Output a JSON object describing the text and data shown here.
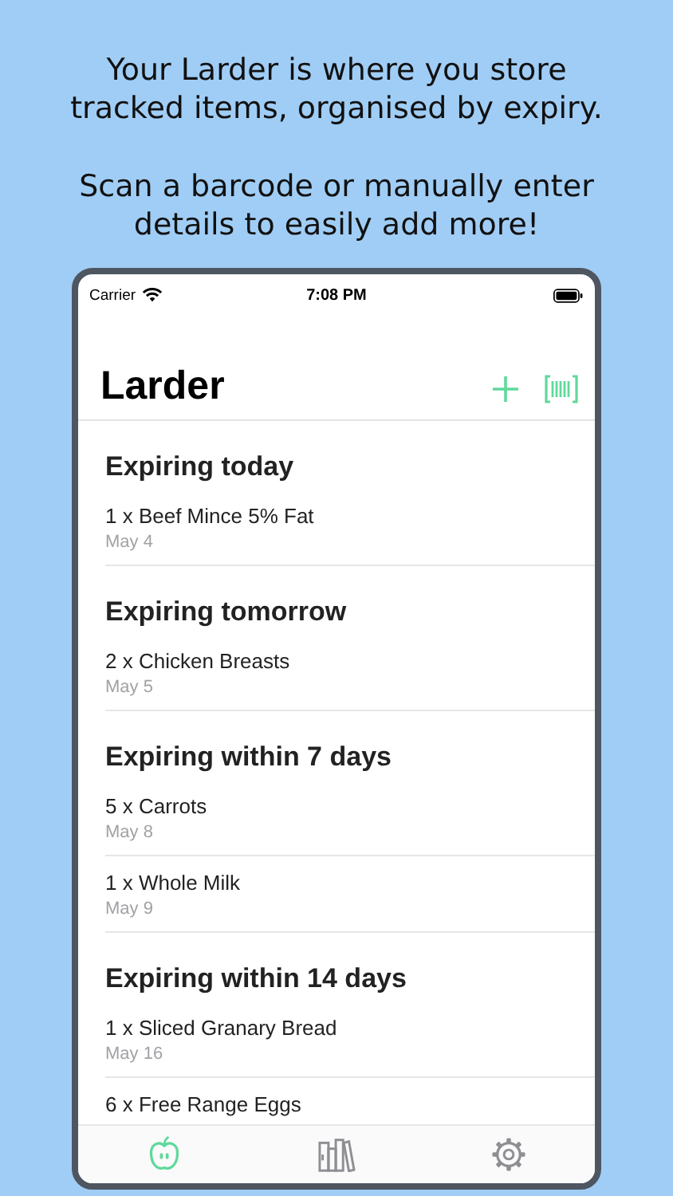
{
  "caption": [
    "Your Larder is where you store tracked items, organised by expiry.",
    "Scan a barcode or manually enter details to easily add more!"
  ],
  "status_bar": {
    "carrier": "Carrier",
    "time": "7:08 PM"
  },
  "nav": {
    "title": "Larder"
  },
  "sections": [
    {
      "title": "Expiring today",
      "items": [
        {
          "name": "1 x Beef Mince 5% Fat",
          "date": "May 4"
        }
      ]
    },
    {
      "title": "Expiring tomorrow",
      "items": [
        {
          "name": "2 x Chicken Breasts",
          "date": "May 5"
        }
      ]
    },
    {
      "title": "Expiring within 7 days",
      "items": [
        {
          "name": "5 x Carrots",
          "date": "May 8"
        },
        {
          "name": "1 x Whole Milk",
          "date": "May 9"
        }
      ]
    },
    {
      "title": "Expiring within 14 days",
      "items": [
        {
          "name": "1 x Sliced Granary Bread",
          "date": "May 16"
        },
        {
          "name": "6 x Free Range Eggs"
        }
      ]
    }
  ],
  "tabs": [
    {
      "kind": "larder",
      "selected": true
    },
    {
      "kind": "library",
      "selected": false
    },
    {
      "kind": "settings",
      "selected": false
    }
  ]
}
